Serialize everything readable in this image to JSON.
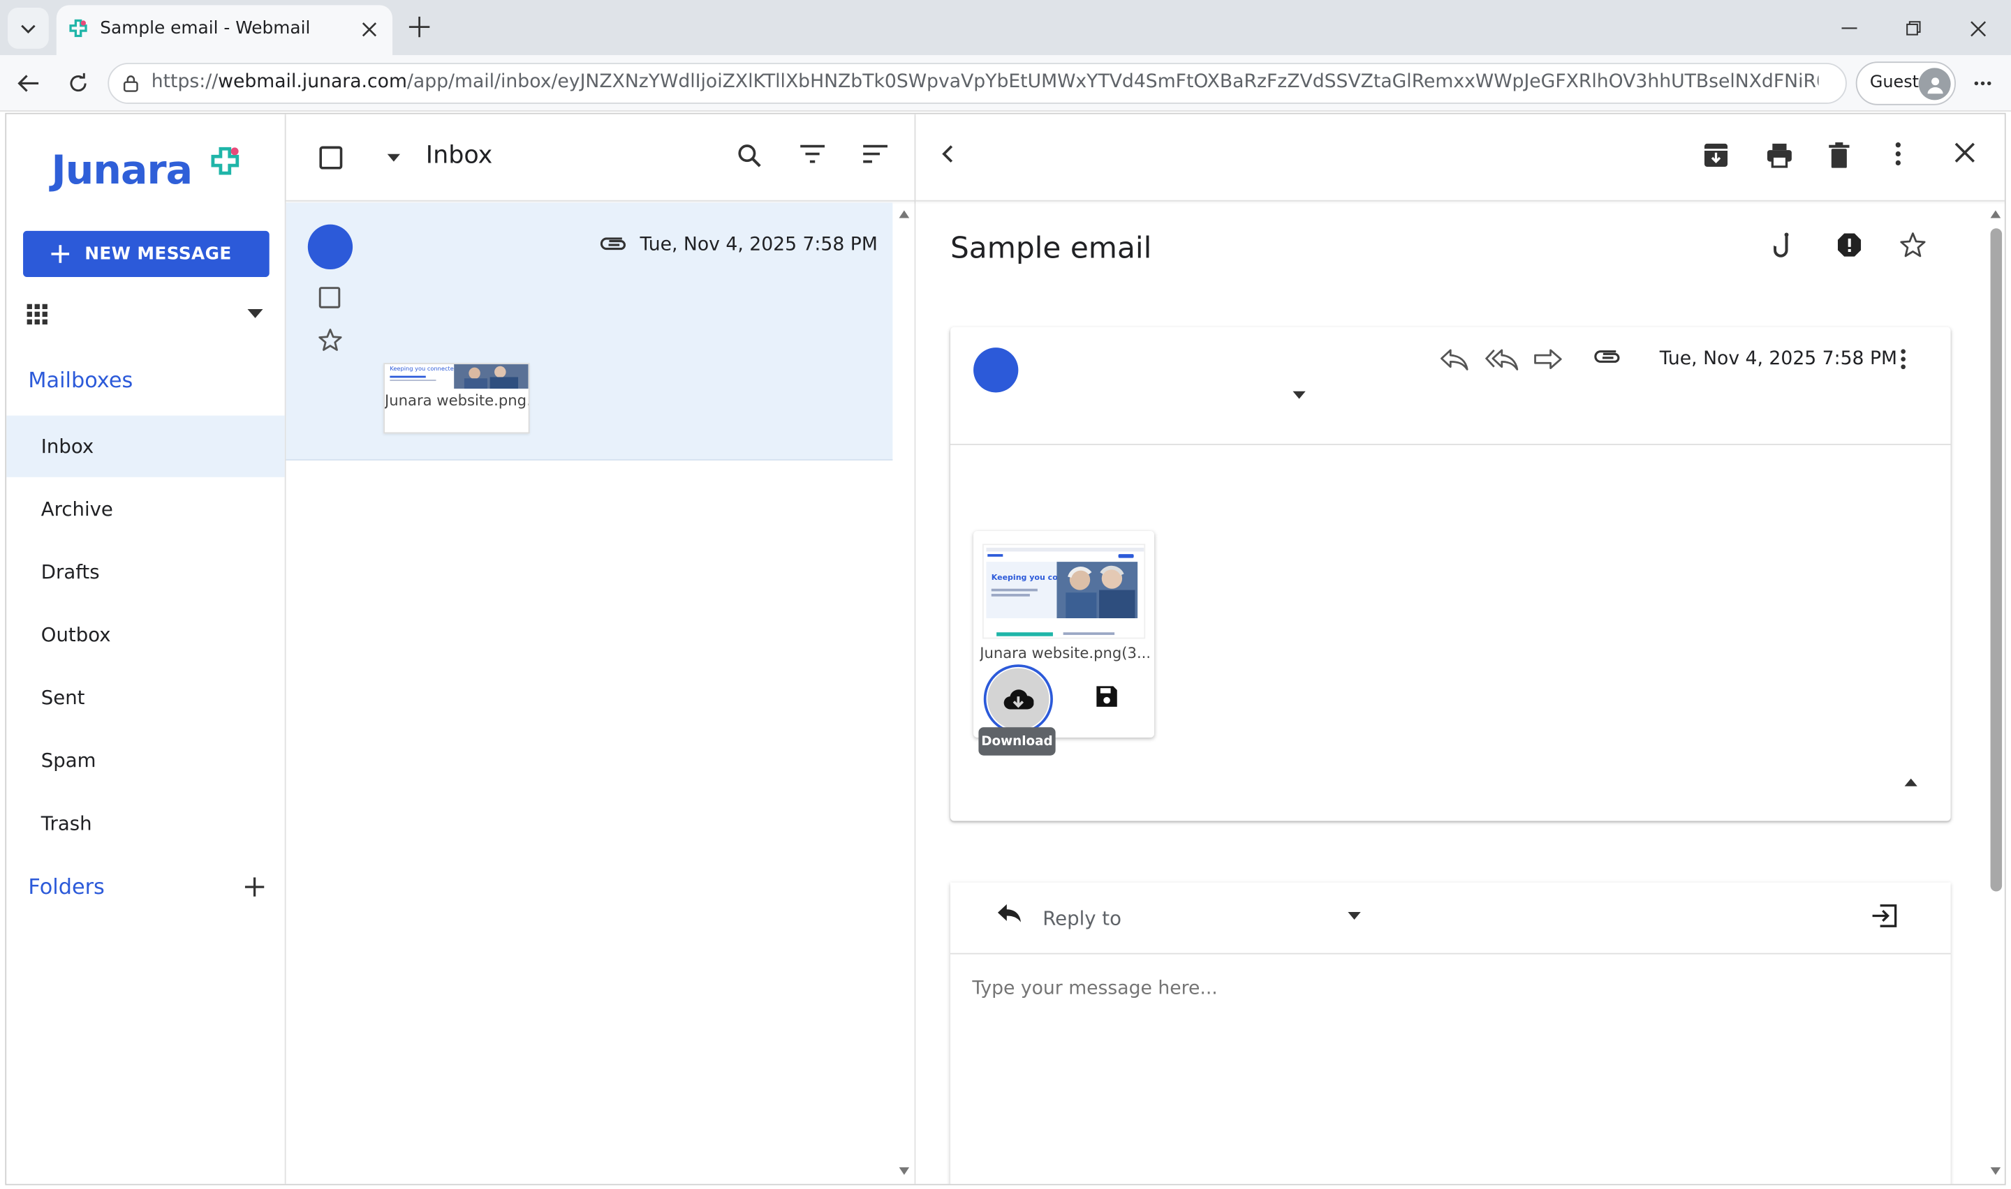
{
  "browser": {
    "tab_title": "Sample email - Webmail",
    "url_prefix": "https://",
    "url_host": "webmail.junara.com",
    "url_path": "/app/mail/inbox/eyJNZXNzYWdlIjoiZXlKTllXbHNZbTk0SWpvaVpYbEtUMWxYTVd4SmFtOXBaRzFzZVdSSVZtaGlRemxxWWpJeGFXRlhOV3hhUTBselNXdFNiR0plYkhSaF...",
    "profile_label": "Guest"
  },
  "sidebar": {
    "logo_text": "Junara",
    "new_message_label": "NEW MESSAGE",
    "mailboxes_title": "Mailboxes",
    "items": [
      {
        "label": "Inbox",
        "active": true
      },
      {
        "label": "Archive",
        "active": false
      },
      {
        "label": "Drafts",
        "active": false
      },
      {
        "label": "Outbox",
        "active": false
      },
      {
        "label": "Sent",
        "active": false
      },
      {
        "label": "Spam",
        "active": false
      },
      {
        "label": "Trash",
        "active": false
      }
    ],
    "folders_title": "Folders"
  },
  "list": {
    "title": "Inbox",
    "message": {
      "date": "Tue, Nov 4, 2025 7:58 PM",
      "attachment_name": "Junara website.png...",
      "thumb_text": "Keeping you connected"
    }
  },
  "reader": {
    "subject": "Sample email",
    "date": "Tue, Nov 4, 2025 7:58 PM",
    "attachment_name": "Junara website.png(3....",
    "attachment_thumb_text": "Keeping you connected",
    "tooltip": "Download",
    "reply_label": "Reply to",
    "reply_placeholder": "Type your message here..."
  },
  "colors": {
    "accent": "#2c5ad9",
    "selected_row": "#e8f1fb",
    "logo_teal": "#1fb5a8",
    "logo_pink": "#e84a7a"
  }
}
